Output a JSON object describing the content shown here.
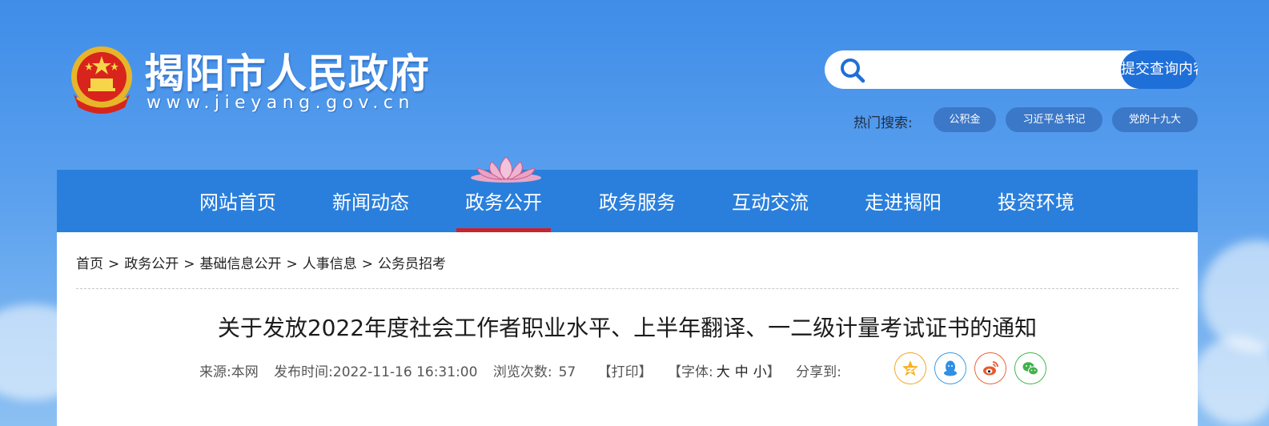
{
  "header": {
    "site_title": "揭阳市人民政府",
    "site_domain": "www.jieyang.gov.cn",
    "search": {
      "placeholder": "",
      "button_label": "提交查询内容"
    },
    "hot_search": {
      "label": "热门搜索:",
      "tags": [
        "公积金",
        "习近平总书记",
        "党的十九大"
      ]
    }
  },
  "nav": {
    "items": [
      "网站首页",
      "新闻动态",
      "政务公开",
      "政务服务",
      "互动交流",
      "走进揭阳",
      "投资环境"
    ],
    "active": "政务公开"
  },
  "breadcrumb": {
    "items": [
      "首页",
      "政务公开",
      "基础信息公开",
      "人事信息",
      "公务员招考"
    ],
    "separator": ">"
  },
  "article": {
    "title": "关于发放2022年度社会工作者职业水平、上半年翻译、一二级计量考试证书的通知",
    "source_label": "来源:",
    "source": "本网",
    "publish_label": "发布时间:",
    "publish_time": "2022-11-16 16:31:00",
    "views_label": "浏览次数:",
    "views": "57",
    "print_label": "【打印】",
    "font_label": "【字体:",
    "font_sizes": [
      "大",
      "中",
      "小"
    ],
    "font_close": "】",
    "share_label": "分享到:"
  },
  "share": {
    "icons": [
      "qzone-icon",
      "qq-icon",
      "weibo-icon",
      "wechat-icon"
    ],
    "colors": [
      "#f5a623",
      "#3a9ae8",
      "#e8643c",
      "#43b74a"
    ]
  },
  "colors": {
    "nav_bg": "#2a7fdc",
    "nav_active_underline": "#c8232c",
    "search_button": "#1f6fd8",
    "hot_tag_bg": "#3c78c8"
  }
}
